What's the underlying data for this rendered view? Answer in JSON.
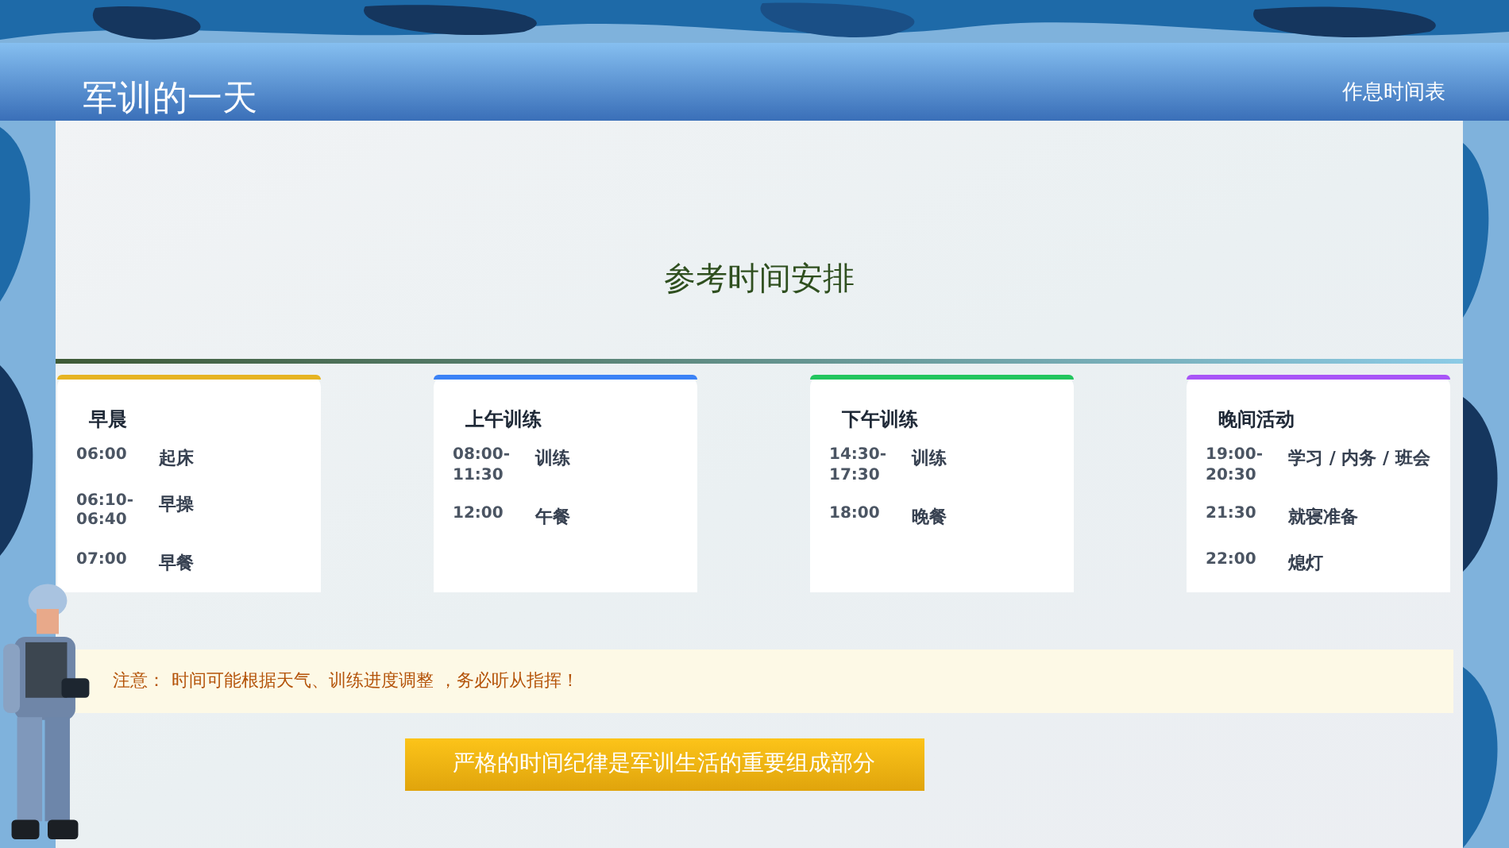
{
  "header": {
    "title": "军训的一天",
    "subtitle": "作息时间表"
  },
  "heading": "参考时间安排",
  "periods": [
    {
      "title": "早晨",
      "color": "#e6b422",
      "entries": [
        {
          "time": "06:00",
          "activity": "起床"
        },
        {
          "time": "06:10-06:40",
          "activity": "早操"
        },
        {
          "time": "07:00",
          "activity": "早餐"
        }
      ]
    },
    {
      "title": "上午训练",
      "color": "#3b82f6",
      "entries": [
        {
          "time": "08:00-11:30",
          "activity": "训练"
        },
        {
          "time": "12:00",
          "activity": "午餐"
        }
      ]
    },
    {
      "title": "下午训练",
      "color": "#22c55e",
      "entries": [
        {
          "time": "14:30-17:30",
          "activity": "训练"
        },
        {
          "time": "18:00",
          "activity": "晚餐"
        }
      ]
    },
    {
      "title": "晚间活动",
      "color": "#a855f7",
      "entries": [
        {
          "time": "19:00-20:30",
          "activity": "学习 / 内务 / 班会"
        },
        {
          "time": "21:30",
          "activity": "就寝准备"
        },
        {
          "time": "22:00",
          "activity": "熄灯"
        }
      ]
    }
  ],
  "notice": {
    "label": "注意：",
    "text": "时间可能根据天气、训练进度调整 ，务必听从指挥！"
  },
  "banner": "严格的时间纪律是军训生活的重要组成部分"
}
